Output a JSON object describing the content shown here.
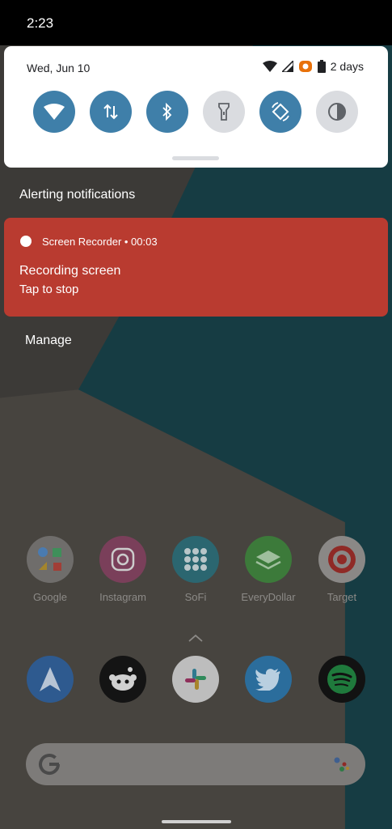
{
  "status_bar": {
    "time": "2:23"
  },
  "quick_settings": {
    "date": "Wed, Jun 10",
    "battery_text": "2 days",
    "tiles": [
      {
        "name": "wifi",
        "state": "on"
      },
      {
        "name": "mobile-data",
        "state": "on"
      },
      {
        "name": "bluetooth",
        "state": "on"
      },
      {
        "name": "flashlight",
        "state": "off"
      },
      {
        "name": "auto-rotate",
        "state": "on"
      },
      {
        "name": "invert-colors",
        "state": "off"
      }
    ]
  },
  "notifications": {
    "section_title": "Alerting notifications",
    "items": [
      {
        "app": "Screen Recorder • 00:03",
        "title": "Recording screen",
        "text": "Tap to stop",
        "color": "#b93b30"
      }
    ],
    "manage_label": "Manage"
  },
  "home": {
    "apps": [
      {
        "label": "Google"
      },
      {
        "label": "Instagram"
      },
      {
        "label": "SoFi"
      },
      {
        "label": "EveryDollar"
      },
      {
        "label": "Target"
      }
    ],
    "dock": [
      {
        "icon": "spark-icon"
      },
      {
        "icon": "reddit-icon"
      },
      {
        "icon": "slack-icon"
      },
      {
        "icon": "twitter-icon"
      },
      {
        "icon": "spotify-icon"
      }
    ]
  },
  "colors": {
    "tile_on": "#3f7fa9",
    "tile_off": "#dadce0",
    "notification_red": "#b93b30"
  }
}
